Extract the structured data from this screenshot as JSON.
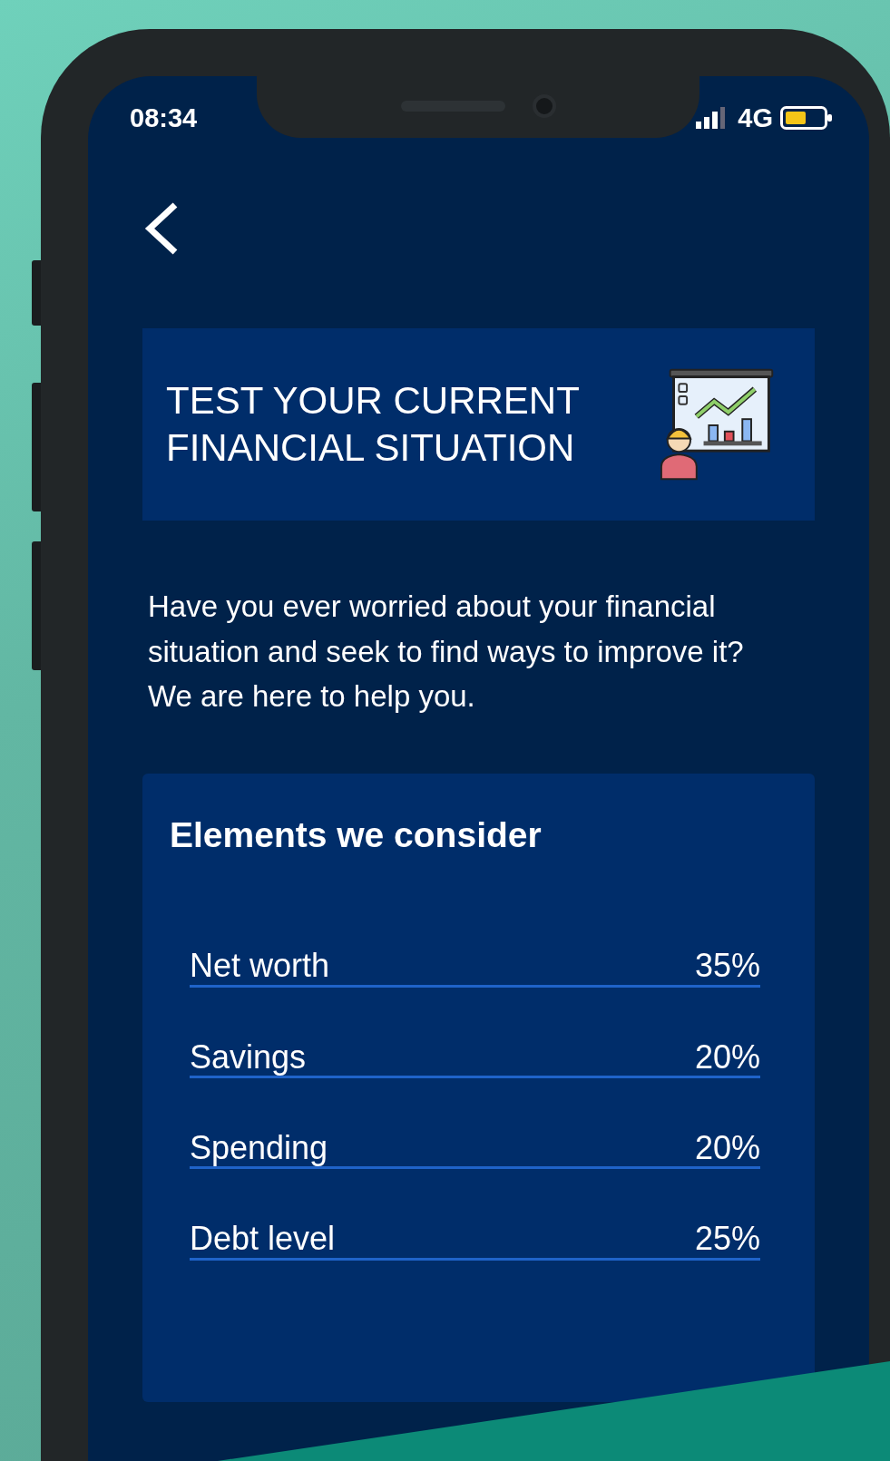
{
  "status_bar": {
    "time": "08:34",
    "network": "4G"
  },
  "banner": {
    "title": "TEST YOUR CURRENT FINANCIAL SITUATION"
  },
  "intro": "Have you ever worried about your financial situation and seek to find ways to improve it? We are here to help you.",
  "card": {
    "title": "Elements we consider",
    "items": [
      {
        "label": "Net worth",
        "value": "35%"
      },
      {
        "label": "Savings",
        "value": "20%"
      },
      {
        "label": "Spending",
        "value": "20%"
      },
      {
        "label": "Debt level",
        "value": "25%"
      }
    ]
  }
}
